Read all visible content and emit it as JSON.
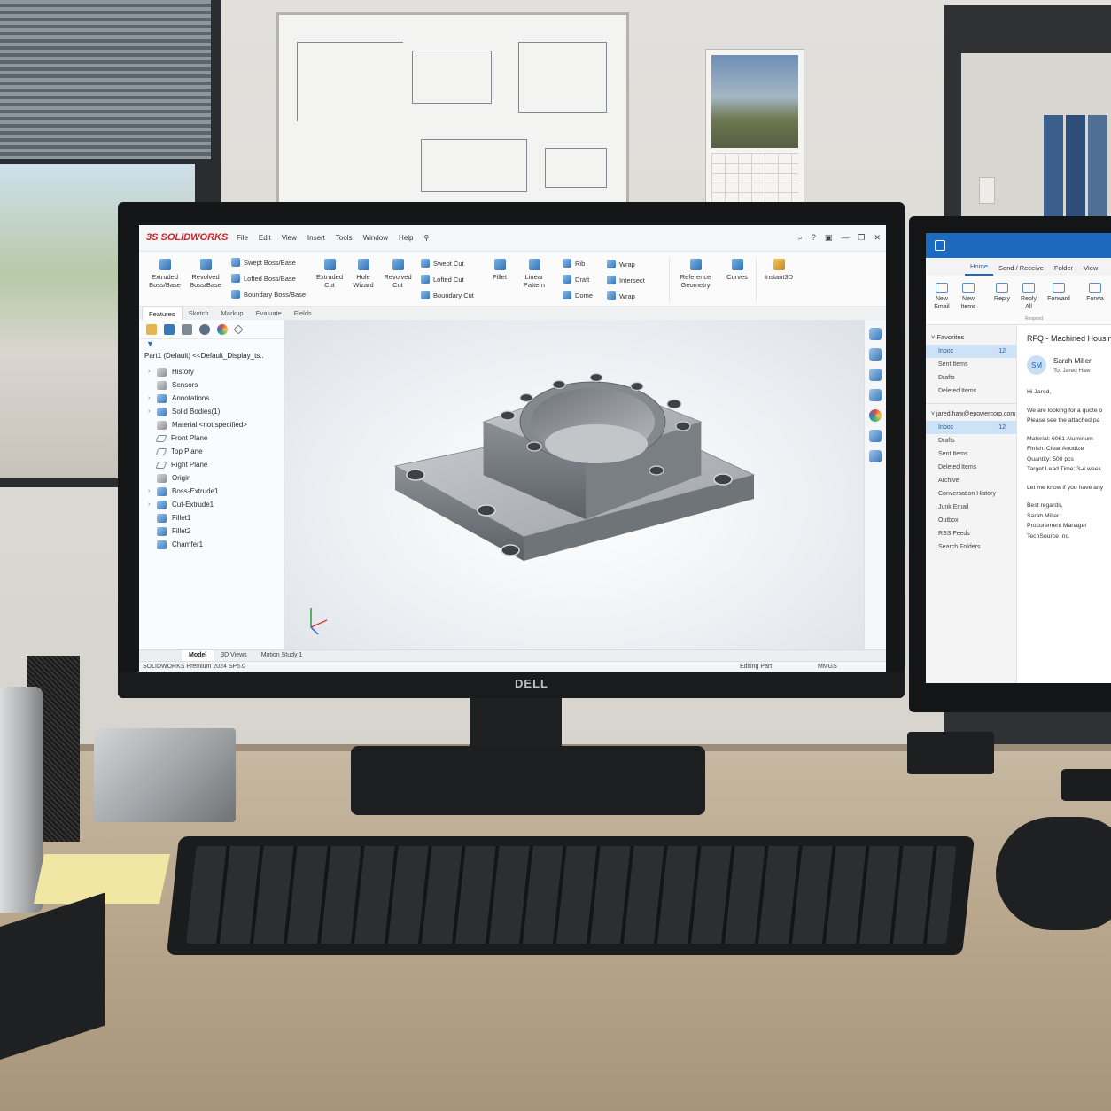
{
  "solidworks": {
    "logo": "SOLIDWORKS",
    "menu": [
      "File",
      "Edit",
      "View",
      "Insert",
      "Tools",
      "Window",
      "Help"
    ],
    "ribbon": {
      "extruded_boss": "Extruded Boss/Base",
      "revolved_boss": "Revolved Boss/Base",
      "swept_boss": "Swept Boss/Base",
      "lofted_boss": "Lofted Boss/Base",
      "boundary_boss": "Boundary Boss/Base",
      "extruded_cut": "Extruded Cut",
      "hole_wizard": "Hole Wizard",
      "revolved_cut": "Revolved Cut",
      "swept_cut": "Swept Cut",
      "lofted_cut": "Lofted Cut",
      "boundary_cut": "Boundary Cut",
      "fillet": "Fillet",
      "linear_pattern": "Linear Pattern",
      "rib": "Rib",
      "draft": "Draft",
      "dome": "Dome",
      "wrap": "Wrap",
      "intersect": "Intersect",
      "wrap2": "Wrap",
      "reference_geometry": "Reference Geometry",
      "curves": "Curves",
      "instant3d": "Instant3D"
    },
    "tabs": [
      "Features",
      "Sketch",
      "Markup",
      "Evaluate",
      "Fields"
    ],
    "active_tab": "Features",
    "tree": {
      "root": "Part1  (Default)  <<Default_Display_ts..",
      "items": [
        {
          "label": "History",
          "icon": "history-icon",
          "expandable": true
        },
        {
          "label": "Sensors",
          "icon": "sensor-icon",
          "expandable": false
        },
        {
          "label": "Annotations",
          "icon": "annotation-icon",
          "expandable": true
        },
        {
          "label": "Solid Bodies(1)",
          "icon": "solid-bodies-icon",
          "expandable": true
        },
        {
          "label": "Material <not specified>",
          "icon": "material-icon",
          "expandable": false
        },
        {
          "label": "Front Plane",
          "icon": "plane-icon",
          "expandable": false
        },
        {
          "label": "Top Plane",
          "icon": "plane-icon",
          "expandable": false
        },
        {
          "label": "Right Plane",
          "icon": "plane-icon",
          "expandable": false
        },
        {
          "label": "Origin",
          "icon": "origin-icon",
          "expandable": false
        },
        {
          "label": "Boss-Extrude1",
          "icon": "boss-extrude-icon",
          "expandable": true
        },
        {
          "label": "Cut-Extrude1",
          "icon": "cut-extrude-icon",
          "expandable": true
        },
        {
          "label": "Fillet1",
          "icon": "fillet-icon",
          "expandable": false
        },
        {
          "label": "Fillet2",
          "icon": "fillet-icon",
          "expandable": false
        },
        {
          "label": "Chamfer1",
          "icon": "chamfer-icon",
          "expandable": false
        }
      ]
    },
    "bottom_tabs": [
      "Model",
      "3D Views",
      "Motion Study 1"
    ],
    "active_bottom_tab": "Model",
    "status": {
      "version": "SOLIDWORKS Premium 2024 SP5.0",
      "mode": "Editing Part",
      "units": "MMGS"
    },
    "colors": {
      "brand_red": "#d2232a",
      "accent_blue": "#2f6fb3"
    }
  },
  "monitor_brand": "DELL",
  "outlook": {
    "tabs": [
      "Home",
      "Send / Receive",
      "Folder",
      "View"
    ],
    "active_tab": "Home",
    "ribbon": [
      "New Email",
      "New Items",
      "Reply",
      "Reply All",
      "Forward",
      "Forwa"
    ],
    "ribbon_group": "Respond",
    "favorites_header": "Favorites",
    "favorites": [
      {
        "label": "Inbox",
        "count": "12",
        "selected": true
      },
      {
        "label": "Sent Items"
      },
      {
        "label": "Drafts"
      },
      {
        "label": "Deleted Items"
      }
    ],
    "account": "jared.haw@epowercorp.com",
    "folders": [
      {
        "label": "Inbox",
        "count": "12",
        "selected": true
      },
      {
        "label": "Drafts"
      },
      {
        "label": "Sent Items"
      },
      {
        "label": "Deleted Items"
      },
      {
        "label": "Archive"
      },
      {
        "label": "Conversation History"
      },
      {
        "label": "Junk Email"
      },
      {
        "label": "Outbox"
      },
      {
        "label": "RSS Feeds"
      },
      {
        "label": "Search Folders"
      }
    ],
    "message": {
      "subject": "RFQ - Machined Housing",
      "initials": "SM",
      "sender": "Sarah Miller",
      "to": "To:  Jared Haw",
      "greeting": "Hi Jared,",
      "line1": "We are looking for a quote o",
      "line2": "Please see the attached pa",
      "material": "Material:   6061 Aluminum",
      "finish": "Finish:      Clear Anodize",
      "quantity": "Quantity:   500 pcs",
      "lead": "Target Lead Time:  3-4 week",
      "closing": "Let me know if you have any",
      "regards": "Best regards,",
      "sig_name": "Sarah Miller",
      "sig_title": "Procurement Manager",
      "sig_company": "TechSource Inc."
    },
    "colors": {
      "brand_blue": "#1b6ac0"
    }
  }
}
